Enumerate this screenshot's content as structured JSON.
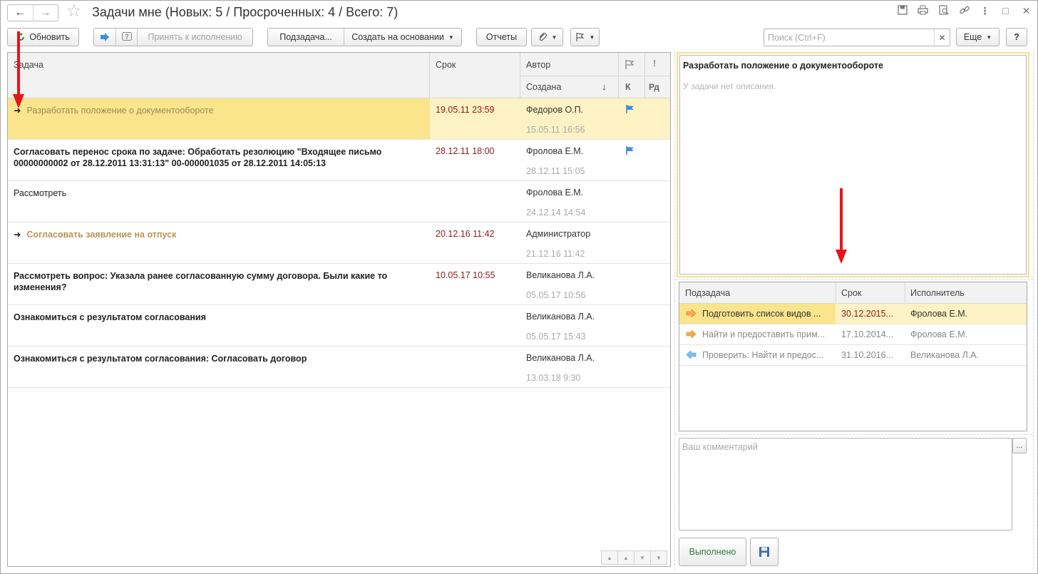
{
  "window": {
    "title": "Задачи мне (Новых: 5 / Просроченных: 4 / Всего: 7)"
  },
  "toolbar": {
    "refresh": "Обновить",
    "accept": "Принять к исполнению",
    "subtask": "Подзадача...",
    "create_based": "Создать на основании",
    "reports": "Отчеты",
    "search_placeholder": "Поиск (Ctrl+F)",
    "more": "Еще",
    "help": "?"
  },
  "table": {
    "headers": {
      "task": "Задача",
      "due": "Срок",
      "author": "Автор",
      "created": "Создана",
      "sort": "↓",
      "k": "К",
      "rd": "Рд"
    },
    "rows": [
      {
        "task": "Разработать положение о документообороте",
        "due": "19.05.11 23:59",
        "author": "Федоров О.П.",
        "created": "15.05.11 16:56"
      },
      {
        "task": "Согласовать перенос срока по задаче: Обработать резолюцию \"Входящее письмо 00000000002 от 28.12.2011 13:31:13\" 00-000001035 от 28.12.2011 14:05:13",
        "due": "28.12.11 18:00",
        "author": "Фролова Е.М.",
        "created": "28.12.11 15:05"
      },
      {
        "task": "Рассмотреть",
        "due": "",
        "author": "Фролова Е.М.",
        "created": "24.12.14 14:54"
      },
      {
        "task": "Согласовать заявление на отпуск",
        "due": "20.12.16 11:42",
        "author": "Администратор",
        "created": "21.12.16 11:42"
      },
      {
        "task": "Рассмотреть вопрос: Указала ранее согласованную сумму договора. Были какие то изменения?",
        "due": "10.05.17 10:55",
        "author": "Великанова Л.А.",
        "created": "05.05.17 10:56"
      },
      {
        "task": "Ознакомиться с результатом согласования",
        "due": "",
        "author": "Великанова Л.А.",
        "created": "05.05.17 15:43"
      },
      {
        "task": "Ознакомиться с результатом согласования: Согласовать договор",
        "due": "",
        "author": "Великанова Л.А.",
        "created": "13.03.18 9:30"
      }
    ]
  },
  "description": {
    "title": "Разработать положение о документообороте",
    "text": "У задачи нет описания."
  },
  "subtasks": {
    "headers": {
      "name": "Подзадача",
      "due": "Срок",
      "executor": "Исполнитель"
    },
    "rows": [
      {
        "name": "Подготовить список видов ...",
        "due": "30.12.2015...",
        "executor": "Фролова Е.М."
      },
      {
        "name": "Найти и предоставить прим...",
        "due": "17.10.2014...",
        "executor": "Фролова Е.М."
      },
      {
        "name": "Проверить: Найти и предос...",
        "due": "31.10.2016...",
        "executor": "Великанова Л.А."
      }
    ]
  },
  "comment": {
    "placeholder": "Ваш комментарий",
    "dots": "..."
  },
  "actions": {
    "done": "Выполнено"
  },
  "colors": {
    "accent_yellow": "#fae58c",
    "overdue_red": "#8b1a1a",
    "done_green": "#2e7d32",
    "annotation_red": "#e8141a"
  }
}
